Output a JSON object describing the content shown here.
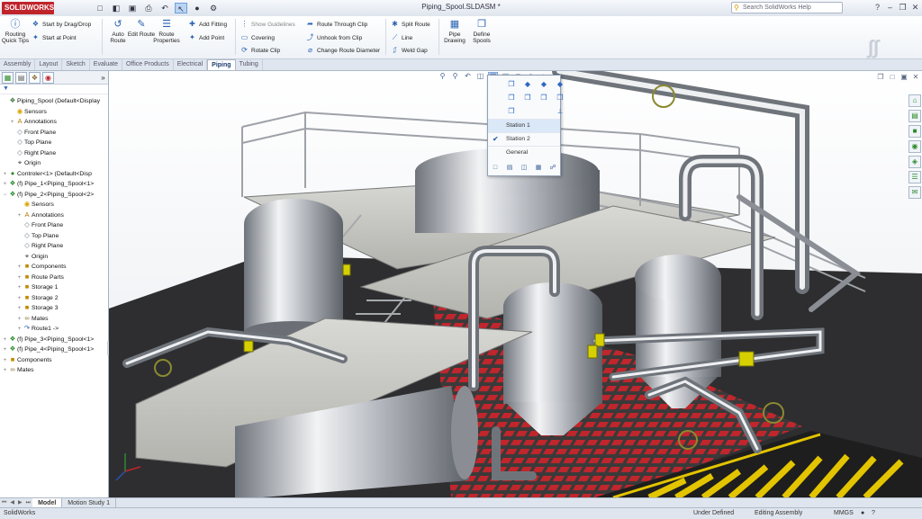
{
  "app": {
    "logo": "SOLIDWORKS",
    "document_title": "Piping_Spool.SLDASM *",
    "help_search_placeholder": "Search SolidWorks Help",
    "quick_access": [
      "new-icon",
      "open-icon",
      "save-icon",
      "print-icon",
      "undo-icon",
      "select-icon",
      "rebuild-icon",
      "options-icon"
    ]
  },
  "ribbon": {
    "routing_quick_tips": "Routing Quick Tips",
    "start_by_drag_drop": "Start by Drag/Drop",
    "start_at_point": "Start at Point",
    "auto_route": "Auto Route",
    "edit_route": "Edit Route",
    "route_properties": "Route Properties",
    "add_fitting": "Add Fitting",
    "add_point": "Add Point",
    "show_guidelines": "Show Guidelines",
    "covering": "Covering",
    "rotate_clip": "Rotate Clip",
    "route_through_clip": "Route Through Clip",
    "unhook_from_clip": "Unhook from Clip",
    "change_route_diameter": "Change Route Diameter",
    "split_route": "Split Route",
    "line": "Line",
    "weld_gap": "Weld Gap",
    "pipe_drawing": "Pipe Drawing",
    "define_spools": "Define Spools"
  },
  "tabs": [
    "Assembly",
    "Layout",
    "Sketch",
    "Evaluate",
    "Office Products",
    "Electrical",
    "Piping",
    "Tubing"
  ],
  "active_tab": "Piping",
  "tree": [
    {
      "label": "Piping_Spool  (Default<Display",
      "icon": "assembly-icon",
      "depth": 0,
      "exp": ""
    },
    {
      "label": "Sensors",
      "icon": "sensors-icon",
      "depth": 1,
      "exp": ""
    },
    {
      "label": "Annotations",
      "icon": "annotations-icon",
      "depth": 1,
      "exp": "+"
    },
    {
      "label": "Front Plane",
      "icon": "plane-icon",
      "depth": 1,
      "exp": ""
    },
    {
      "label": "Top Plane",
      "icon": "plane-icon",
      "depth": 1,
      "exp": ""
    },
    {
      "label": "Right Plane",
      "icon": "plane-icon",
      "depth": 1,
      "exp": ""
    },
    {
      "label": "Origin",
      "icon": "origin-icon",
      "depth": 1,
      "exp": ""
    },
    {
      "label": "Controler<1> (Default<Disp",
      "icon": "part-icon",
      "depth": 0,
      "exp": "+"
    },
    {
      "label": "(f) Pipe_1<Piping_Spool<1>",
      "icon": "subassembly-icon",
      "depth": 0,
      "exp": "+"
    },
    {
      "label": "(f) Pipe_2<Piping_Spool<2>",
      "icon": "subassembly-icon",
      "depth": 0,
      "exp": "-"
    },
    {
      "label": "Sensors",
      "icon": "sensors-icon",
      "depth": 2,
      "exp": ""
    },
    {
      "label": "Annotations",
      "icon": "annotations-icon",
      "depth": 2,
      "exp": "+"
    },
    {
      "label": "Front Plane",
      "icon": "plane-icon",
      "depth": 2,
      "exp": ""
    },
    {
      "label": "Top Plane",
      "icon": "plane-icon",
      "depth": 2,
      "exp": ""
    },
    {
      "label": "Right Plane",
      "icon": "plane-icon",
      "depth": 2,
      "exp": ""
    },
    {
      "label": "Origin",
      "icon": "origin-icon",
      "depth": 2,
      "exp": ""
    },
    {
      "label": "Components",
      "icon": "folder-icon",
      "depth": 2,
      "exp": "+"
    },
    {
      "label": "Route Parts",
      "icon": "folder-icon",
      "depth": 2,
      "exp": "+"
    },
    {
      "label": "Storage 1",
      "icon": "folder-icon",
      "depth": 2,
      "exp": "+"
    },
    {
      "label": "Storage 2",
      "icon": "folder-icon",
      "depth": 2,
      "exp": "+"
    },
    {
      "label": "Storage 3",
      "icon": "folder-icon",
      "depth": 2,
      "exp": "+"
    },
    {
      "label": "Mates",
      "icon": "mates-icon",
      "depth": 2,
      "exp": "+"
    },
    {
      "label": "Route1 -> ",
      "icon": "route-icon",
      "depth": 2,
      "exp": "+"
    },
    {
      "label": "(f) Pipe_3<Piping_Spool<1>",
      "icon": "subassembly-icon",
      "depth": 0,
      "exp": "+"
    },
    {
      "label": "(f) Pipe_4<Piping_Spool<1>",
      "icon": "subassembly-icon",
      "depth": 0,
      "exp": "+"
    },
    {
      "label": "Components",
      "icon": "folder-icon",
      "depth": 0,
      "exp": "+"
    },
    {
      "label": "Mates",
      "icon": "mates-icon",
      "depth": 0,
      "exp": "+"
    }
  ],
  "popup": {
    "views": [
      "front-view-icon",
      "back-view-icon",
      "left-view-icon",
      "right-view-icon",
      "top-view-icon",
      "bottom-view-icon",
      "isometric-view-icon",
      "trimetric-view-icon",
      "dimetric-view-icon",
      "normal-to-icon"
    ],
    "items": [
      {
        "label": "Station 1",
        "checked": false,
        "hover": true
      },
      {
        "label": "Station 2",
        "checked": true,
        "hover": false
      },
      {
        "label": "General",
        "checked": false,
        "hover": false
      }
    ]
  },
  "bottom_tabs": [
    "Model",
    "Motion Study 1"
  ],
  "active_bottom_tab": "Model",
  "status": {
    "app_name": "SolidWorks",
    "under_defined": "Under Defined",
    "editing": "Editing Assembly",
    "units": "MMGS"
  },
  "colors": {
    "brand_red": "#c0242b",
    "floor_red": "#c0262c",
    "hazard_yellow": "#e3c400",
    "valve_yellow": "#d7d000",
    "steel": "#b9bcc1"
  }
}
